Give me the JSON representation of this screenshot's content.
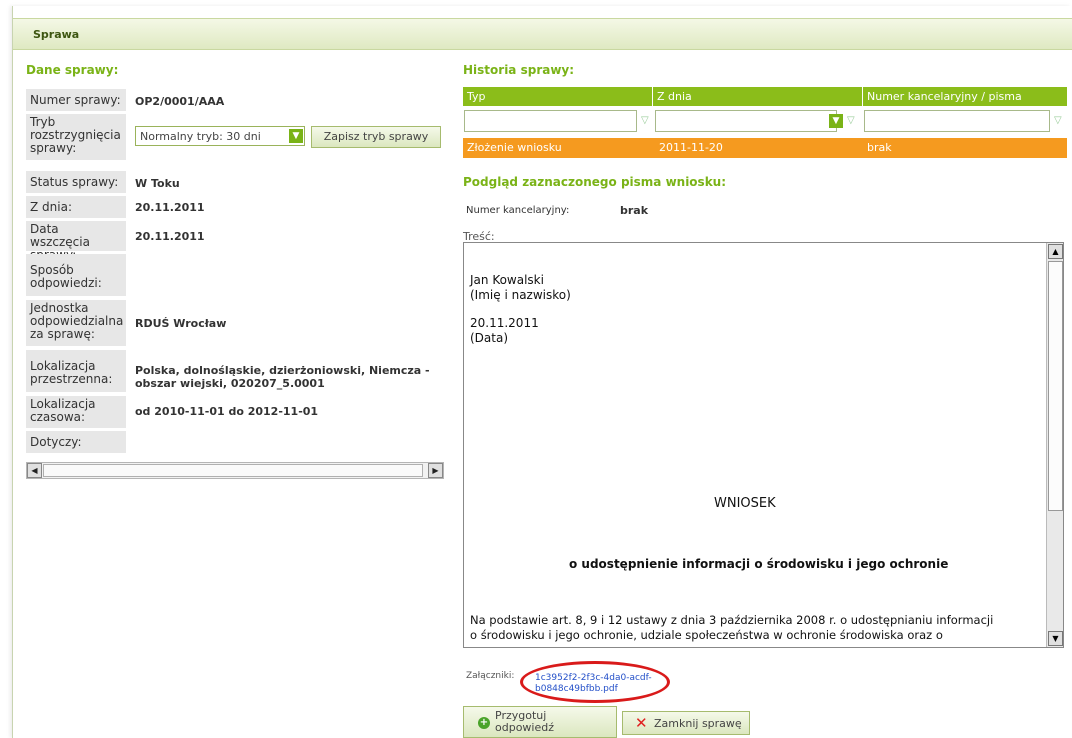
{
  "panel": {
    "title": "Sprawa"
  },
  "dane": {
    "title": "Dane sprawy:",
    "rows": [
      {
        "label": "Numer sprawy:",
        "value": "OP2/0001/AAA"
      },
      {
        "label": "Tryb rozstrzygnięcia sprawy:",
        "value": ""
      },
      {
        "label": "Status sprawy:",
        "value": "W Toku"
      },
      {
        "label": "Z dnia:",
        "value": "20.11.2011"
      },
      {
        "label": "Data wszczęcia sprawy:",
        "value": "20.11.2011"
      },
      {
        "label": "Sposób odpowiedzi:",
        "value": ""
      },
      {
        "label": "Jednostka odpowiedzialna za sprawę:",
        "value": "RDUŚ Wrocław"
      },
      {
        "label": "Lokalizacja przestrzenna:",
        "value": "Polska, dolnośląskie, dzierżoniowski, Niemcza - obszar wiejski, 020207_5.0001"
      },
      {
        "label": "Lokalizacja czasowa:",
        "value": "od 2010-11-01 do 2012-11-01"
      },
      {
        "label": "Dotyczy:",
        "value": ""
      }
    ],
    "tryb_select": "Normalny tryb: 30 dni",
    "tryb_button": "Zapisz tryb sprawy"
  },
  "historia": {
    "title": "Historia sprawy:",
    "columns": [
      "Typ",
      "Z dnia",
      "Numer kancelaryjny / pisma"
    ],
    "rows": [
      [
        "Złożenie wniosku",
        "2011-11-20",
        "brak"
      ]
    ]
  },
  "podglad": {
    "title": "Podgląd zaznaczonego pisma wniosku:",
    "numer_label": "Numer kancelaryjny:",
    "numer_value": "brak",
    "tresc_label": "Treść:",
    "doc_lines": {
      "name": "Jan Kowalski",
      "name_caption": "(Imię i nazwisko)",
      "date": "20.11.2011",
      "date_caption": "(Data)",
      "heading": "WNIOSEK",
      "subheading": "o udostępnienie informacji o środowisku i jego ochronie",
      "body1": "Na podstawie art. 8, 9 i 12 ustawy z dnia 3 października 2008 r. o udostępnianiu informacji",
      "body2": "o środowisku i jego ochronie, udziale społeczeństwa w ochronie środowiska oraz o"
    }
  },
  "zalaczniki": {
    "label": "Załączniki:",
    "file_line1": "1c3952f2-2f3c-4da0-acdf-",
    "file_line2": "b0848c49bfbb.pdf"
  },
  "actions": {
    "prepare": "Przygotuj odpowiedź",
    "close": "Zamknij sprawę"
  },
  "colors": {
    "accent": "#7ab317",
    "header_green": "#8bbd1a",
    "selected_row": "#f59a1f",
    "highlight": "#d91a1a"
  }
}
